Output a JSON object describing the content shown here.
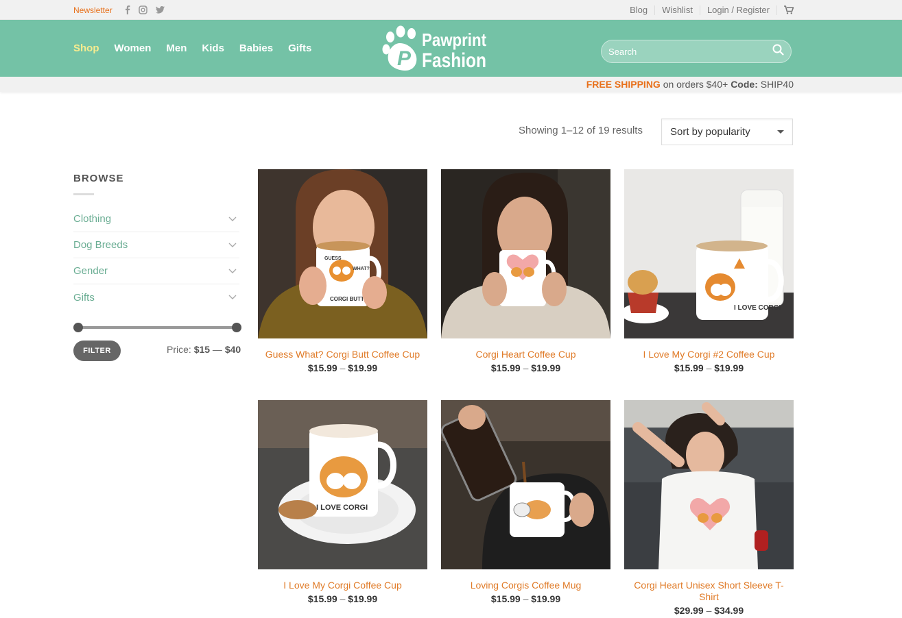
{
  "topbar": {
    "newsletter": "Newsletter",
    "social_icons": [
      "facebook-icon",
      "instagram-icon",
      "twitter-icon"
    ],
    "links": [
      "Blog",
      "Wishlist",
      "Login / Register"
    ],
    "cart_icon": "cart-icon"
  },
  "header": {
    "nav": [
      "Shop",
      "Women",
      "Men",
      "Kids",
      "Babies",
      "Gifts"
    ],
    "active_nav": "Shop",
    "logo_line1": "Pawprint",
    "logo_line2": "Fashion",
    "search_placeholder": "Search",
    "background": "#74c2a6",
    "active_color": "#f7ec8f"
  },
  "shipping": {
    "highlight": "FREE SHIPPING",
    "text": " on orders $40+ ",
    "code_label": "Code:",
    "code": " SHIP40"
  },
  "toolbar": {
    "results": "Showing 1–12 of 19 results",
    "sort_label": "Sort by popularity"
  },
  "sidebar": {
    "title": "BROWSE",
    "categories": [
      "Clothing",
      "Dog Breeds",
      "Gender",
      "Gifts"
    ],
    "filter_label": "FILTER",
    "price_label": "Price:",
    "price_min": "$15",
    "price_sep": " — ",
    "price_max": "$40"
  },
  "products": [
    {
      "title": "Guess What? Corgi Butt Coffee Cup",
      "price_low": "$15.99",
      "price_high": "$19.99"
    },
    {
      "title": "Corgi Heart Coffee Cup",
      "price_low": "$15.99",
      "price_high": "$19.99"
    },
    {
      "title": "I Love My Corgi #2 Coffee Cup",
      "price_low": "$15.99",
      "price_high": "$19.99"
    },
    {
      "title": "I Love My Corgi Coffee Cup",
      "price_low": "$15.99",
      "price_high": "$19.99"
    },
    {
      "title": "Loving Corgis Coffee Mug",
      "price_low": "$15.99",
      "price_high": "$19.99"
    },
    {
      "title": "Corgi Heart Unisex Short Sleeve T-Shirt",
      "price_low": "$29.99",
      "price_high": "$34.99"
    }
  ],
  "product_image_text": {
    "mug1_top": "GUESS",
    "mug1_side": "WHAT?",
    "mug1_bottom": "CORGI BUTT",
    "mug3_text": "I LOVE CORGI",
    "mug4_text": "I LOVE CORGI"
  },
  "price_separator": " – "
}
